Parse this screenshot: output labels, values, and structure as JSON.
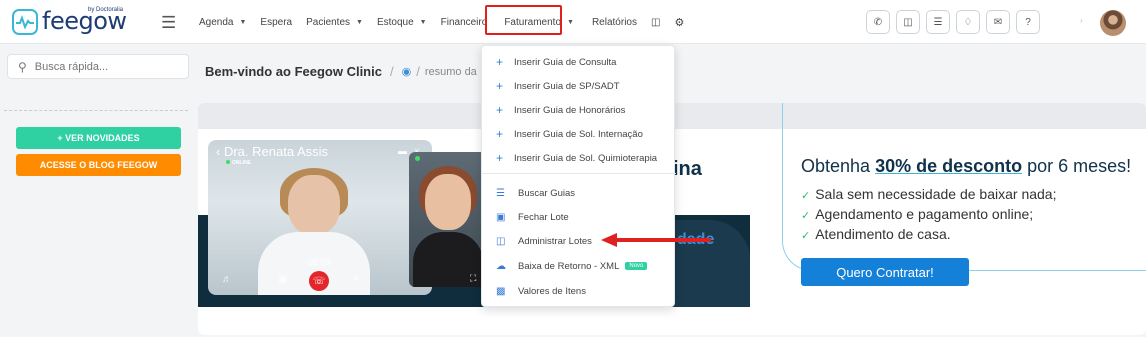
{
  "brand": {
    "name": "feegow",
    "by": "by Doctoralia"
  },
  "nav": {
    "items": [
      {
        "label": "Agenda",
        "has_caret": true
      },
      {
        "label": "Espera",
        "has_caret": false
      },
      {
        "label": "Pacientes",
        "has_caret": true
      },
      {
        "label": "Estoque",
        "has_caret": true
      },
      {
        "label": "Financeiro",
        "has_caret": false
      },
      {
        "label": "Faturamento",
        "has_caret": true,
        "active": true
      },
      {
        "label": "Relatórios",
        "has_caret": false
      }
    ],
    "extra_icons": [
      "database-icon",
      "settings-icon"
    ]
  },
  "topbar_icons": [
    "phone-icon",
    "inbox-icon",
    "checklist-icon",
    "bell-icon",
    "chat-icon",
    "help-icon"
  ],
  "sidebar": {
    "search_placeholder": "Busca rápida...",
    "news_button": "+ VER NOVIDADES",
    "blog_button": "ACESSE O BLOG FEEGOW"
  },
  "breadcrumb": {
    "title": "Bem-vindo ao Feegow Clinic",
    "sub": "resumo da"
  },
  "banner": {
    "video_name": "Dra. Renata Assis",
    "online": "ONLINE",
    "time": "02:03",
    "title_partial": "ina",
    "sub_partial": "dade",
    "promo": {
      "title_pre": "Obtenha ",
      "title_bold": "30% de desconto",
      "title_post": " por 6 meses!",
      "items": [
        "Sala sem necessidade de baixar nada;",
        "Agendamento e pagamento online;",
        "Atendimento de casa."
      ],
      "button": "Quero Contratar!"
    }
  },
  "dropdown": {
    "insert_items": [
      "Inserir Guia de Consulta",
      "Inserir Guia de SP/SADT",
      "Inserir Guia de Honorários",
      "Inserir Guia de Sol. Internação",
      "Inserir Guia de Sol. Quimioterapia"
    ],
    "items": [
      {
        "label": "Buscar Guias",
        "icon": "list-icon"
      },
      {
        "label": "Fechar Lote",
        "icon": "archive-icon"
      },
      {
        "label": "Administrar Lotes",
        "icon": "folder-open-icon"
      },
      {
        "label": "Baixa de Retorno - XML",
        "icon": "cloud-download-icon",
        "badge": "Novo"
      },
      {
        "label": "Valores de Itens",
        "icon": "money-icon"
      }
    ]
  },
  "colors": {
    "accent": "#3bb7d6",
    "brand_dark": "#1e3b73",
    "highlight": "#e02020",
    "green": "#2fd0a1",
    "orange": "#ff8c00",
    "blue": "#1580d8"
  }
}
